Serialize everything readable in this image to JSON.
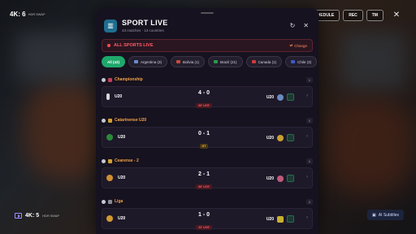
{
  "topbar": {
    "left_label": "4K: 6",
    "left_small": "HDR  5WAP",
    "buttons": [
      "HEDULE",
      "REC",
      "TM"
    ],
    "close": "✕"
  },
  "bottombar": {
    "left_label": "4K: 5",
    "left_small": "HDR  5WAP",
    "ai_subtitles": "AI Subtitles"
  },
  "panel": {
    "title": "SPORT LIVE",
    "subtitle": "43 matches  ·  13 countries",
    "refresh_icon": "↻",
    "close_icon": "✕",
    "live_label": "ALL SPORTS LIVE",
    "change_label": "Change",
    "tabs": [
      {
        "label": "All (43)",
        "active": true
      },
      {
        "label": "Argentina (3)"
      },
      {
        "label": "Bolivia (1)"
      },
      {
        "label": "Brazil (21)"
      },
      {
        "label": "Canada (1)"
      },
      {
        "label": "Chile (3)"
      }
    ],
    "leagues": [
      {
        "name": "Championship",
        "count": "1",
        "match": {
          "home": "U20",
          "away": "U20",
          "score": "4 - 0",
          "status": "66' LIVE",
          "status_type": "live"
        }
      },
      {
        "name": "Catarinense U20",
        "count": "1",
        "match": {
          "home": "U20",
          "away": "U20",
          "score": "0 - 1",
          "status": "HT",
          "status_type": "ht"
        }
      },
      {
        "name": "Cearense - 2",
        "count": "1",
        "match": {
          "home": "U20",
          "away": "U20",
          "score": "2 - 1",
          "status": "66' LIVE",
          "status_type": "live"
        }
      },
      {
        "name": "Liga",
        "count": "2",
        "match": {
          "home": "U20",
          "away": "U20",
          "score": "1 - 0",
          "status": "33' LIVE",
          "status_type": "live"
        }
      }
    ]
  },
  "colors": {
    "accent_green": "#1fa86b",
    "live_red": "#ff5a6a",
    "league_orange": "#f2a24a",
    "ht_yellow": "#f2b24a"
  }
}
